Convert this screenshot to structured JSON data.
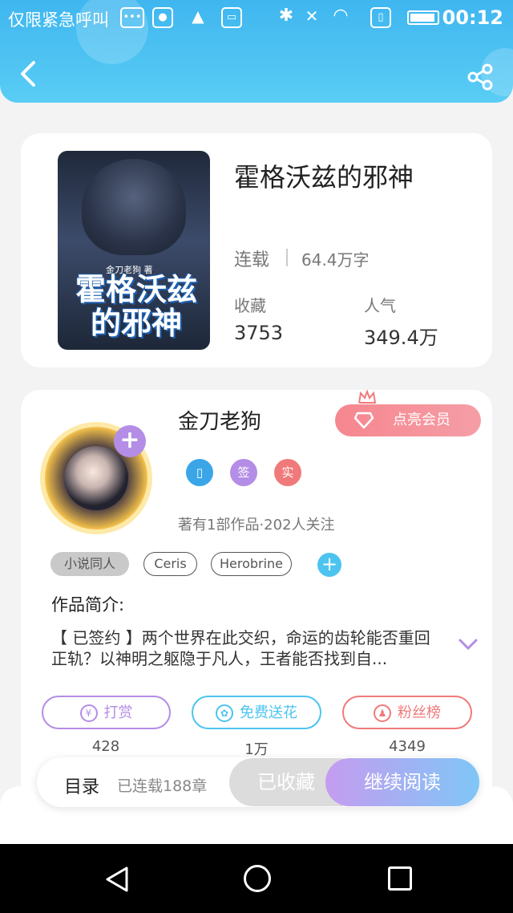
{
  "status_bar": {
    "carrier": "仅限紧急呼叫",
    "time": "00:12"
  },
  "header": {
    "back_icon": "back-arrow-icon",
    "share_icon": "share-icon"
  },
  "book": {
    "cover_author": "金刀老狗 著",
    "cover_title": "霍格沃兹的邪神",
    "title": "霍格沃兹的邪神",
    "status": "连载",
    "word_count": "64.4万字",
    "collect_label": "收藏",
    "collect_value": "3753",
    "popularity_label": "人气",
    "popularity_value": "349.4万"
  },
  "author": {
    "name": "金刀老狗",
    "vip_button": "点亮会员",
    "badges": [
      {
        "label": "",
        "color": "#3aa6e8"
      },
      {
        "label": "签",
        "color": "#b48de6"
      },
      {
        "label": "实",
        "color": "#f07a7a"
      }
    ],
    "stats": "著有1部作品·202人关注"
  },
  "tags": [
    "小说同人",
    "Ceris",
    "Herobrine"
  ],
  "intro": {
    "title": "作品简介:",
    "text": "【 已签约 】两个世界在此交织，命运的齿轮能否重回正轨？以神明之躯隐于凡人，王者能否找到自..."
  },
  "actions": [
    {
      "label": "打赏",
      "count": "428",
      "color": "#b48de6"
    },
    {
      "label": "免费送花",
      "count": "1万",
      "color": "#4cc4ef"
    },
    {
      "label": "粉丝榜",
      "count": "4349",
      "color": "#f07a7a"
    }
  ],
  "bottom_bar": {
    "catalog": "目录",
    "chapters": "已连载188章",
    "collected": "已收藏",
    "continue": "继续阅读"
  }
}
